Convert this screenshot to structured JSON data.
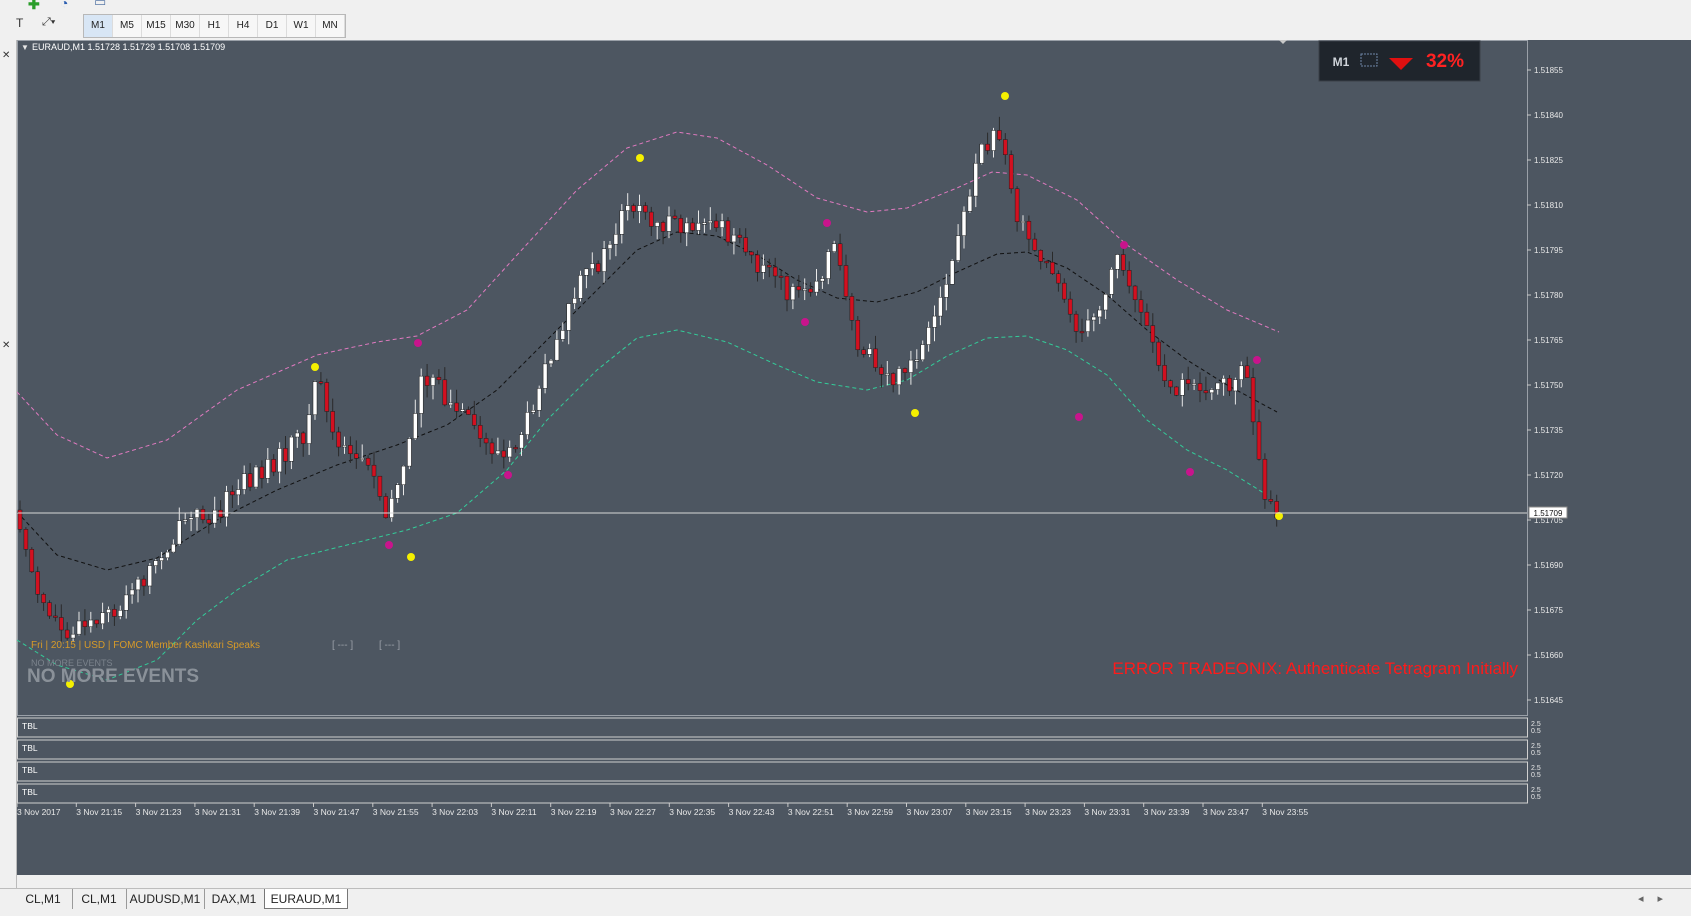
{
  "toolbar": {
    "timeframes": [
      "M1",
      "M5",
      "M15",
      "M30",
      "H1",
      "H4",
      "D1",
      "W1",
      "MN"
    ],
    "active_timeframe": "M1"
  },
  "chart": {
    "header": "EURAUD,M1  1.51728 1.51729 1.51708 1.51709",
    "current_price_label": "1.51709",
    "price_axis": [
      "1.51855",
      "1.51840",
      "1.51825",
      "1.51810",
      "1.51795",
      "1.51780",
      "1.51765",
      "1.51750",
      "1.51735",
      "1.51720",
      "1.51705",
      "1.51690",
      "1.51675",
      "1.51660",
      "1.51645"
    ],
    "time_axis": [
      "3 Nov 2017",
      "3 Nov 21:15",
      "3 Nov 21:23",
      "3 Nov 21:31",
      "3 Nov 21:39",
      "3 Nov 21:47",
      "3 Nov 21:55",
      "3 Nov 22:03",
      "3 Nov 22:11",
      "3 Nov 22:19",
      "3 Nov 22:27",
      "3 Nov 22:35",
      "3 Nov 22:43",
      "3 Nov 22:51",
      "3 Nov 22:59",
      "3 Nov 23:07",
      "3 Nov 23:15",
      "3 Nov 23:23",
      "3 Nov 23:31",
      "3 Nov 23:39",
      "3 Nov 23:47",
      "3 Nov 23:55"
    ],
    "news_line": "Fri  |  20:15  |  USD  |  FOMC Member Kashkari Speaks",
    "news_brackets": [
      "[ --- ]",
      "[ --- ]"
    ],
    "no_more_events_small": "NO MORE EVENTS",
    "no_more_events": "NO MORE EVENTS",
    "error_text": "ERROR TRADEONIX: Authenticate Tetragram Initially",
    "widget": {
      "tf_label": "M1",
      "percent": "32%",
      "colors": {
        "arrow": "#e01010",
        "percent": "#ff2222"
      }
    },
    "subpanels": [
      {
        "label": "TBL",
        "scale_top": "2.5",
        "scale_bottom": "0.5"
      },
      {
        "label": "TBL",
        "scale_top": "2.5",
        "scale_bottom": "0.5"
      },
      {
        "label": "TBL",
        "scale_top": "2.5",
        "scale_bottom": "0.5"
      },
      {
        "label": "TBL",
        "scale_top": "2.5",
        "scale_bottom": "0.5"
      }
    ],
    "colors": {
      "background": "#4d5661",
      "bull_candle": "#ffffff",
      "bear_candle": "#d21020",
      "upper_band": "#e07ac0",
      "lower_band": "#33cc99",
      "middle_band": "#111111",
      "signal_yellow": "#f5f000",
      "signal_magenta": "#c8148c",
      "news_text": "#d79a28",
      "error_text": "#ff1a1a"
    }
  },
  "chart_data": {
    "type": "candlestick",
    "title": "EURAUD,M1",
    "ylim": [
      1.5164,
      1.51865
    ],
    "current_price": 1.51709,
    "ohlc_header": {
      "open": 1.51728,
      "high": 1.51729,
      "low": 1.51708,
      "close": 1.51709
    }
  },
  "tabs": [
    "CL,M1",
    "CL,M1",
    "AUDUSD,M1",
    "DAX,M1",
    "EURAUD,M1"
  ],
  "active_tab": "EURAUD,M1"
}
